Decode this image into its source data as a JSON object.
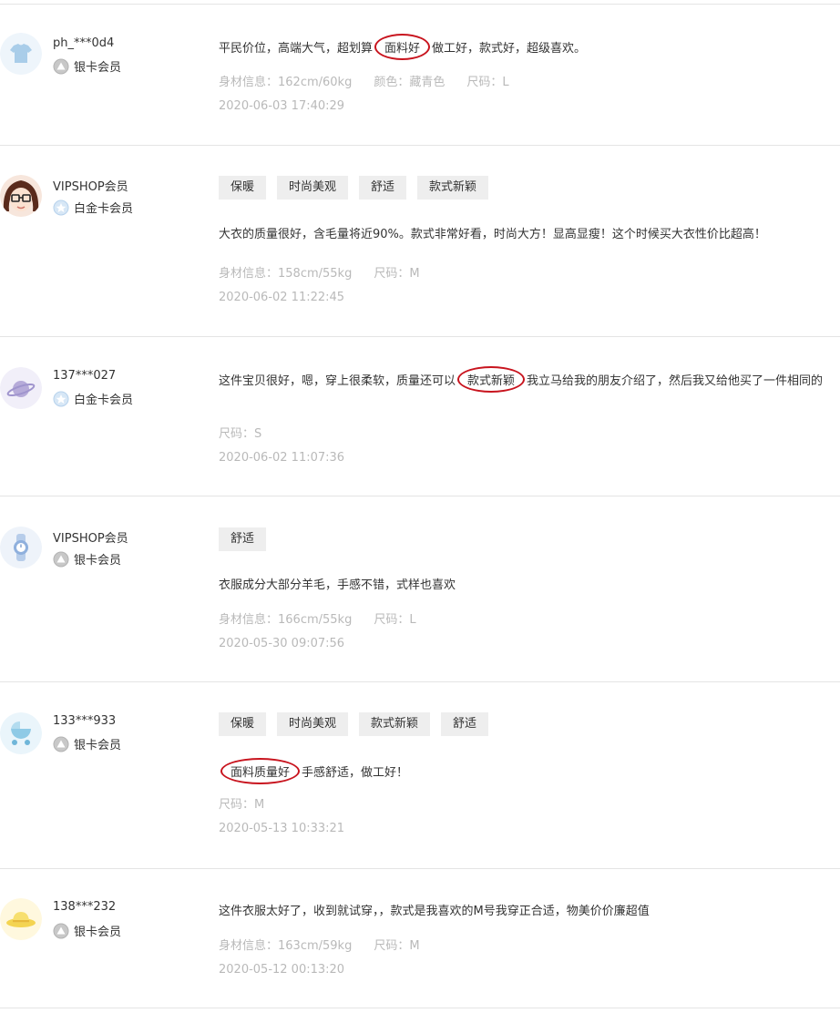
{
  "colors": {
    "highlight_ring": "#c8141e",
    "muted_text": "#b9b9b9",
    "tag_bg": "#eeeeee",
    "divider": "#e4e4e4"
  },
  "reviews": [
    {
      "username": "ph_***0d4",
      "level": "银卡会员",
      "level_icon": "silver-card-icon",
      "avatar_icon": "tshirt-avatar-icon",
      "tags": [],
      "text_before": "平民价位，高端大气，超划算",
      "highlight": "面料好",
      "text_after": "做工好，款式好，超级喜欢。",
      "meta": [
        "身材信息：162cm/60kg",
        "颜色：藏青色",
        "尺码：L"
      ],
      "date": "2020-06-03 17:40:29"
    },
    {
      "username": "VIPSHOP会员",
      "level": "白金卡会员",
      "level_icon": "platinum-card-icon",
      "avatar_icon": "girl-with-glasses-avatar",
      "tags": [
        "保暖",
        "时尚美观",
        "舒适",
        "款式新颖"
      ],
      "text_before": "大衣的质量很好，含毛量将近90%。款式非常好看，时尚大方！显高显瘦！这个时候买大衣性价比超高！",
      "highlight": "",
      "text_after": "",
      "meta": [
        "身材信息：158cm/55kg",
        "尺码：M"
      ],
      "date": "2020-06-02 11:22:45"
    },
    {
      "username": "137***027",
      "level": "白金卡会员",
      "level_icon": "platinum-card-icon",
      "avatar_icon": "planet-avatar-icon",
      "tags": [],
      "text_before": "这件宝贝很好，嗯，穿上很柔软，质量还可以",
      "highlight": "款式新颖",
      "text_after": "我立马给我的朋友介绍了，然后我又给他买了一件相同的",
      "meta": [
        "尺码：S"
      ],
      "date": "2020-06-02 11:07:36"
    },
    {
      "username": "VIPSHOP会员",
      "level": "银卡会员",
      "level_icon": "silver-card-icon",
      "avatar_icon": "watch-avatar-icon",
      "tags": [
        "舒适"
      ],
      "text_before": "衣服成分大部分羊毛，手感不错，式样也喜欢",
      "highlight": "",
      "text_after": "",
      "meta": [
        "身材信息：166cm/55kg",
        "尺码：L"
      ],
      "date": "2020-05-30 09:07:56"
    },
    {
      "username": "133***933",
      "level": "银卡会员",
      "level_icon": "silver-card-icon",
      "avatar_icon": "stroller-avatar-icon",
      "tags": [
        "保暖",
        "时尚美观",
        "款式新颖",
        "舒适"
      ],
      "text_before": "",
      "highlight": "面料质量好",
      "text_after": "手感舒适，做工好！",
      "meta": [
        "尺码：M"
      ],
      "date": "2020-05-13 10:33:21"
    },
    {
      "username": "138***232",
      "level": "银卡会员",
      "level_icon": "silver-card-icon",
      "avatar_icon": "hat-avatar-icon",
      "tags": [],
      "text_before": "这件衣服太好了，收到就试穿，，款式是我喜欢的M号我穿正合适，物美价价廉超值",
      "highlight": "",
      "text_after": "",
      "meta": [
        "身材信息：163cm/59kg",
        "尺码：M"
      ],
      "date": "2020-05-12 00:13:20"
    }
  ]
}
